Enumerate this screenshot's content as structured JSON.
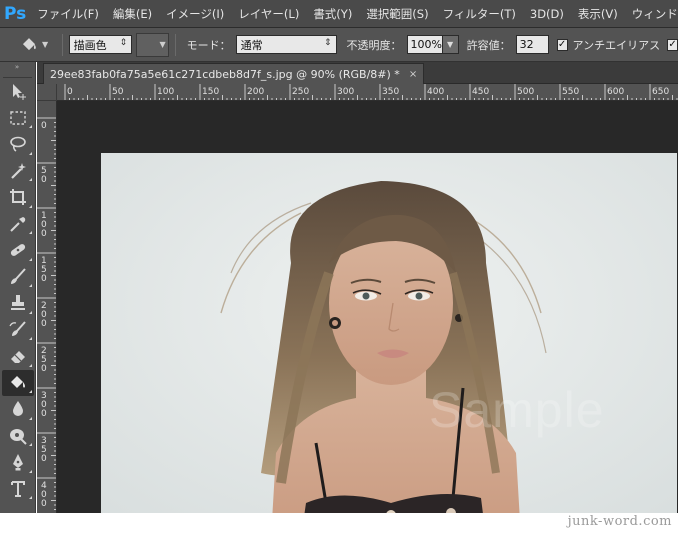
{
  "app": {
    "logo": "Ps"
  },
  "menu": [
    "ファイル(F)",
    "編集(E)",
    "イメージ(I)",
    "レイヤー(L)",
    "書式(Y)",
    "選択範囲(S)",
    "フィルター(T)",
    "3D(D)",
    "表示(V)",
    "ウィンドウ(W)"
  ],
  "options": {
    "fill_source": "描画色",
    "mode_label": "モード：",
    "mode_value": "通常",
    "opacity_label": "不透明度：",
    "opacity_value": "100%",
    "tolerance_label": "許容値：",
    "tolerance_value": "32",
    "antialias_label": "アンチエイリアス",
    "antialias_checked": true
  },
  "toolbar": {
    "grip": "»",
    "tools": [
      "move-tool",
      "marquee-tool",
      "lasso-tool",
      "magic-wand-tool",
      "crop-tool",
      "eyedropper-tool",
      "healing-brush-tool",
      "brush-tool",
      "clone-stamp-tool",
      "history-brush-tool",
      "eraser-tool",
      "paint-bucket-tool",
      "blur-tool",
      "dodge-tool",
      "pen-tool",
      "type-tool"
    ],
    "active_tool": "paint-bucket-tool"
  },
  "document": {
    "tab_title": "29ee83fab0fa75a5e61c271cdbeb8d7f_s.jpg @ 90% (RGB/8#) *",
    "close_glyph": "×",
    "hruler_labels": [
      "0",
      "50",
      "100",
      "150",
      "200",
      "250",
      "300",
      "350",
      "400",
      "450",
      "500",
      "550",
      "600",
      "650"
    ],
    "vruler_labels": [
      "0",
      "50",
      "100",
      "150",
      "200",
      "250",
      "300",
      "350",
      "400"
    ],
    "watermark": "Sample"
  },
  "credit": "junk-word.com",
  "colors": {
    "menubar": "#4a4a4a",
    "panel": "#535353",
    "workspace": "#282828",
    "accent": "#31a8ff"
  }
}
